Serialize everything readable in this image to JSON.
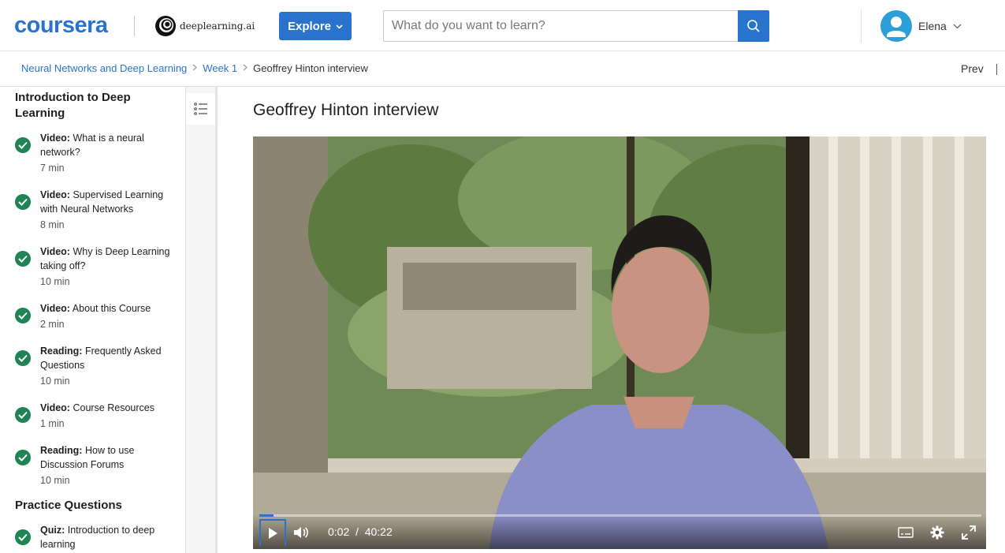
{
  "header": {
    "logo_text": "coursera",
    "partner_text": "deeplearning.ai",
    "explore_label": "Explore",
    "search_placeholder": "What do you want to learn?",
    "user_name": "Elena",
    "accent_color": "#2a73cc"
  },
  "breadcrumb": {
    "items": [
      "Neural Networks and Deep Learning",
      "Week 1"
    ],
    "current": "Geoffrey Hinton interview",
    "prev_label": "Prev"
  },
  "sidebar": {
    "sections": [
      {
        "title": "Introduction to Deep Learning",
        "items": [
          {
            "type": "Video:",
            "title": "What is a neural network?",
            "duration": "7 min"
          },
          {
            "type": "Video:",
            "title": "Supervised Learning with Neural Networks",
            "duration": "8 min"
          },
          {
            "type": "Video:",
            "title": "Why is Deep Learning taking off?",
            "duration": "10 min"
          },
          {
            "type": "Video:",
            "title": "About this Course",
            "duration": "2 min"
          },
          {
            "type": "Reading:",
            "title": "Frequently Asked Questions",
            "duration": "10 min"
          },
          {
            "type": "Video:",
            "title": "Course Resources",
            "duration": "1 min"
          },
          {
            "type": "Reading:",
            "title": "How to use Discussion Forums",
            "duration": "10 min"
          }
        ]
      },
      {
        "title": "Practice Questions",
        "items": [
          {
            "type": "Quiz:",
            "title": "Introduction to deep learning",
            "duration": ""
          }
        ]
      }
    ]
  },
  "main": {
    "title": "Geoffrey Hinton interview",
    "video": {
      "current_time": "0:02",
      "time_separator": "/",
      "duration": "40:22",
      "progress_fraction": 0.0008
    }
  }
}
